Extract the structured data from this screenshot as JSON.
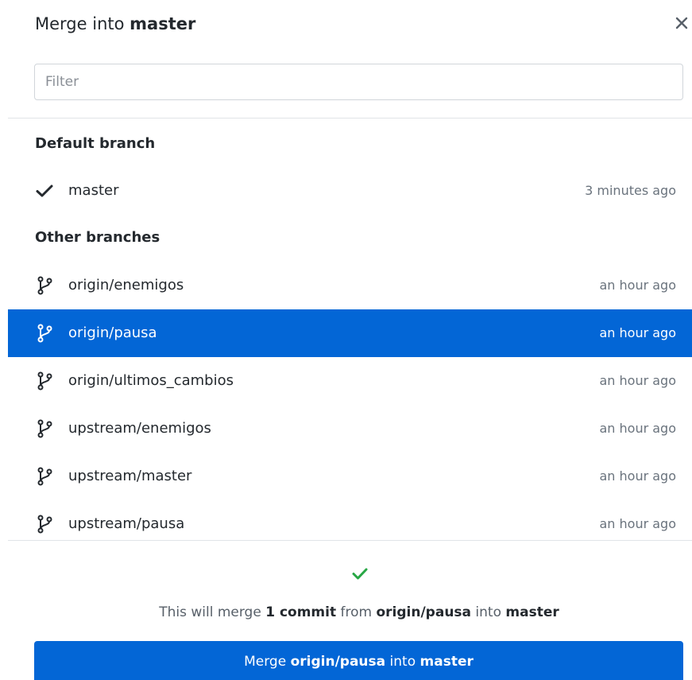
{
  "dialog": {
    "title_prefix": "Merge into",
    "title_branch": "master",
    "close_icon": "close-icon"
  },
  "filter": {
    "placeholder": "Filter",
    "value": ""
  },
  "default_section": {
    "label": "Default branch",
    "branch": {
      "name": "master",
      "time": "3 minutes ago",
      "icon": "checkmark-icon"
    }
  },
  "other_section": {
    "label": "Other branches",
    "branches": [
      {
        "name": "origin/enemigos",
        "time": "an hour ago",
        "icon": "git-branch-icon"
      },
      {
        "name": "origin/pausa",
        "time": "an hour ago",
        "icon": "git-branch-icon",
        "selected": true
      },
      {
        "name": "origin/ultimos_cambios",
        "time": "an hour ago",
        "icon": "git-branch-icon"
      },
      {
        "name": "upstream/enemigos",
        "time": "an hour ago",
        "icon": "git-branch-icon"
      },
      {
        "name": "upstream/master",
        "time": "an hour ago",
        "icon": "git-branch-icon"
      },
      {
        "name": "upstream/pausa",
        "time": "an hour ago",
        "icon": "git-branch-icon"
      }
    ]
  },
  "summary": {
    "prefix": "This will merge",
    "commit_count": "1 commit",
    "from_word": "from",
    "source": "origin/pausa",
    "into_word": "into",
    "target": "master"
  },
  "merge_button": {
    "prefix": "Merge",
    "source": "origin/pausa",
    "into_word": "into",
    "target": "master"
  },
  "colors": {
    "accent": "#0366d6",
    "success": "#28a745",
    "muted_text": "#6a737d"
  }
}
